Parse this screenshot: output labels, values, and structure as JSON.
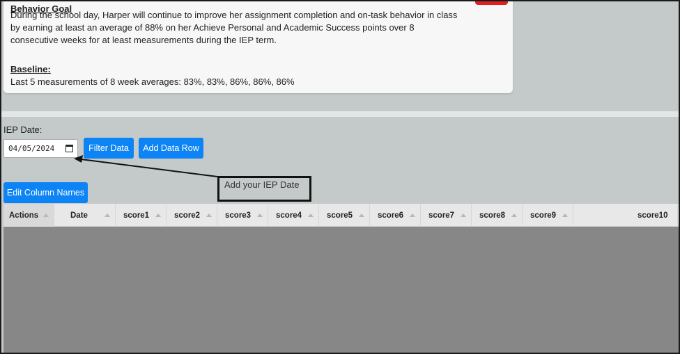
{
  "goal": {
    "heading": "Behavior Goal",
    "text": "During the school day, Harper will continue to improve her assignment completion and on-task behavior in class by earning at least an average of 88% on her Achieve Personal and Academic Success points over 8 consecutive weeks for at least measurements during the IEP term.",
    "baseline_heading": "Baseline:",
    "baseline_text": "Last 5 measurements of 8 week averages: 83%, 83%, 86%, 86%, 86%"
  },
  "controls": {
    "iep_label": "IEP Date:",
    "iep_date_value": "04/05/2024",
    "filter_label": "Filter Data",
    "add_row_label": "Add Data Row",
    "edit_columns_label": "Edit Column Names"
  },
  "callout": {
    "text": "Add your IEP Date"
  },
  "grid": {
    "columns": [
      "Actions",
      "Date",
      "score1",
      "score2",
      "score3",
      "score4",
      "score5",
      "score6",
      "score7",
      "score8",
      "score9",
      "score10"
    ]
  },
  "colors": {
    "accent": "#0d84f5",
    "alert": "#e02020",
    "page_bg": "#c4cac9",
    "grid_body": "#878787"
  }
}
